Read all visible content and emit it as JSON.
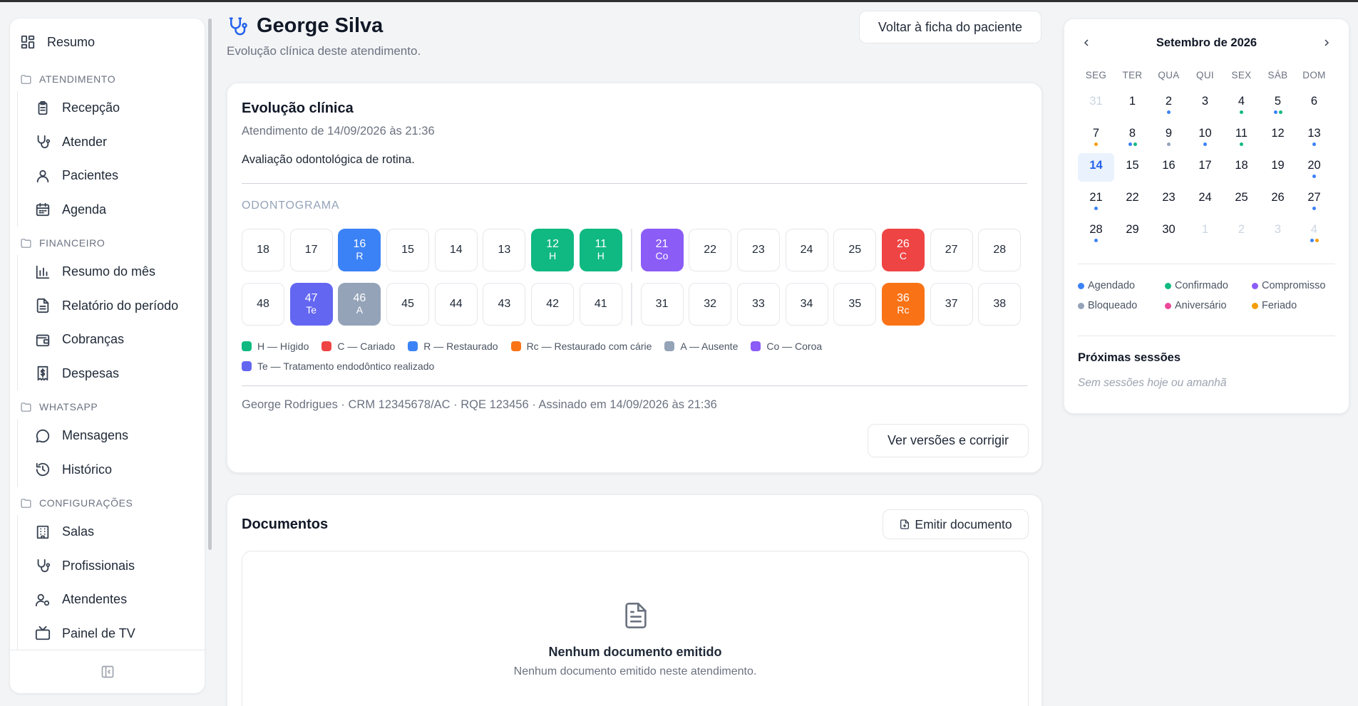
{
  "sidebar": {
    "summary_label": "Resumo",
    "sections": [
      {
        "title": "ATENDIMENTO",
        "items": [
          {
            "label": "Recepção",
            "icon": "clipboard-icon"
          },
          {
            "label": "Atender",
            "icon": "stethoscope-icon"
          },
          {
            "label": "Pacientes",
            "icon": "user-icon"
          },
          {
            "label": "Agenda",
            "icon": "calendar-icon"
          }
        ]
      },
      {
        "title": "FINANCEIRO",
        "items": [
          {
            "label": "Resumo do mês",
            "icon": "bar-chart-icon"
          },
          {
            "label": "Relatório do período",
            "icon": "file-text-icon"
          },
          {
            "label": "Cobranças",
            "icon": "wallet-icon"
          },
          {
            "label": "Despesas",
            "icon": "dollar-receipt-icon"
          }
        ]
      },
      {
        "title": "WHATSAPP",
        "items": [
          {
            "label": "Mensagens",
            "icon": "message-circle-icon"
          },
          {
            "label": "Histórico",
            "icon": "history-icon"
          }
        ]
      },
      {
        "title": "CONFIGURAÇÕES",
        "items": [
          {
            "label": "Salas",
            "icon": "building-icon"
          },
          {
            "label": "Profissionais",
            "icon": "stethoscope-icon"
          },
          {
            "label": "Atendentes",
            "icon": "user-cog-icon"
          },
          {
            "label": "Painel de TV",
            "icon": "tv-icon"
          }
        ]
      }
    ]
  },
  "header": {
    "title": "George Silva",
    "subtitle": "Evolução clínica deste atendimento.",
    "back_button": "Voltar à ficha do paciente"
  },
  "evolution": {
    "title": "Evolução clínica",
    "date": "Atendimento de 14/09/2026 às 21:36",
    "text": "Avaliação odontológica de rotina.",
    "odontogram_label": "ODONTOGRAMA",
    "upper_right": [
      {
        "n": "18",
        "code": ""
      },
      {
        "n": "17",
        "code": ""
      },
      {
        "n": "16",
        "code": "R"
      },
      {
        "n": "15",
        "code": ""
      },
      {
        "n": "14",
        "code": ""
      },
      {
        "n": "13",
        "code": ""
      },
      {
        "n": "12",
        "code": "H"
      },
      {
        "n": "11",
        "code": "H"
      }
    ],
    "upper_left": [
      {
        "n": "21",
        "code": "Co"
      },
      {
        "n": "22",
        "code": ""
      },
      {
        "n": "23",
        "code": ""
      },
      {
        "n": "24",
        "code": ""
      },
      {
        "n": "25",
        "code": ""
      },
      {
        "n": "26",
        "code": "C"
      },
      {
        "n": "27",
        "code": ""
      },
      {
        "n": "28",
        "code": ""
      }
    ],
    "lower_right": [
      {
        "n": "48",
        "code": ""
      },
      {
        "n": "47",
        "code": "Te"
      },
      {
        "n": "46",
        "code": "A"
      },
      {
        "n": "45",
        "code": ""
      },
      {
        "n": "44",
        "code": ""
      },
      {
        "n": "43",
        "code": ""
      },
      {
        "n": "42",
        "code": ""
      },
      {
        "n": "41",
        "code": ""
      }
    ],
    "lower_left": [
      {
        "n": "31",
        "code": ""
      },
      {
        "n": "32",
        "code": ""
      },
      {
        "n": "33",
        "code": ""
      },
      {
        "n": "34",
        "code": ""
      },
      {
        "n": "35",
        "code": ""
      },
      {
        "n": "36",
        "code": "Rc"
      },
      {
        "n": "37",
        "code": ""
      },
      {
        "n": "38",
        "code": ""
      }
    ],
    "legend": [
      {
        "code": "H",
        "label": "H — Hígido",
        "color": "#10b981"
      },
      {
        "code": "C",
        "label": "C — Cariado",
        "color": "#ef4444"
      },
      {
        "code": "R",
        "label": "R — Restaurado",
        "color": "#3b82f6"
      },
      {
        "code": "Rc",
        "label": "Rc — Restaurado com cárie",
        "color": "#f97316"
      },
      {
        "code": "A",
        "label": "A — Ausente",
        "color": "#94a3b8"
      },
      {
        "code": "Co",
        "label": "Co — Coroa",
        "color": "#8b5cf6"
      },
      {
        "code": "Te",
        "label": "Te — Tratamento endodôntico realizado",
        "color": "#6366f1"
      }
    ],
    "signature": "George Rodrigues · CRM 12345678/AC · RQE 123456 · Assinado em 14/09/2026 às 21:36",
    "versions_button": "Ver versões e corrigir"
  },
  "documents": {
    "title": "Documentos",
    "emit_button": "Emitir documento",
    "empty_title": "Nenhum documento emitido",
    "empty_subtitle": "Nenhum documento emitido neste atendimento."
  },
  "calendar": {
    "month": "Setembro de 2026",
    "weekdays": [
      "SEG",
      "TER",
      "QUA",
      "QUI",
      "SEX",
      "SÁB",
      "DOM"
    ],
    "today": "14",
    "weeks": [
      [
        {
          "d": "31",
          "m": true,
          "dots": []
        },
        {
          "d": "1",
          "dots": []
        },
        {
          "d": "2",
          "dots": [
            "agendado"
          ]
        },
        {
          "d": "3",
          "dots": []
        },
        {
          "d": "4",
          "dots": [
            "confirmado"
          ]
        },
        {
          "d": "5",
          "dots": [
            "agendado",
            "confirmado"
          ]
        },
        {
          "d": "6",
          "dots": []
        }
      ],
      [
        {
          "d": "7",
          "dots": [
            "feriado"
          ]
        },
        {
          "d": "8",
          "dots": [
            "agendado",
            "confirmado"
          ]
        },
        {
          "d": "9",
          "dots": [
            "bloqueado"
          ]
        },
        {
          "d": "10",
          "dots": [
            "agendado"
          ]
        },
        {
          "d": "11",
          "dots": [
            "confirmado"
          ]
        },
        {
          "d": "12",
          "dots": []
        },
        {
          "d": "13",
          "dots": [
            "agendado"
          ]
        }
      ],
      [
        {
          "d": "14",
          "dots": [],
          "today": true
        },
        {
          "d": "15",
          "dots": []
        },
        {
          "d": "16",
          "dots": []
        },
        {
          "d": "17",
          "dots": []
        },
        {
          "d": "18",
          "dots": []
        },
        {
          "d": "19",
          "dots": []
        },
        {
          "d": "20",
          "dots": [
            "agendado"
          ]
        }
      ],
      [
        {
          "d": "21",
          "dots": [
            "agendado"
          ]
        },
        {
          "d": "22",
          "dots": []
        },
        {
          "d": "23",
          "dots": []
        },
        {
          "d": "24",
          "dots": []
        },
        {
          "d": "25",
          "dots": []
        },
        {
          "d": "26",
          "dots": []
        },
        {
          "d": "27",
          "dots": [
            "agendado"
          ]
        }
      ],
      [
        {
          "d": "28",
          "dots": [
            "agendado"
          ]
        },
        {
          "d": "29",
          "dots": []
        },
        {
          "d": "30",
          "dots": []
        },
        {
          "d": "1",
          "m": true,
          "dots": []
        },
        {
          "d": "2",
          "m": true,
          "dots": []
        },
        {
          "d": "3",
          "m": true,
          "dots": []
        },
        {
          "d": "4",
          "m": true,
          "dots": [
            "agendado",
            "feriado"
          ]
        }
      ]
    ],
    "legend": [
      {
        "key": "agendado",
        "label": "Agendado",
        "color": "#3b82f6"
      },
      {
        "key": "confirmado",
        "label": "Confirmado",
        "color": "#10b981"
      },
      {
        "key": "compromisso",
        "label": "Compromisso",
        "color": "#8b5cf6"
      },
      {
        "key": "bloqueado",
        "label": "Bloqueado",
        "color": "#94a3b8"
      },
      {
        "key": "aniversario",
        "label": "Aniversário",
        "color": "#ec4899"
      },
      {
        "key": "feriado",
        "label": "Feriado",
        "color": "#f59e0b"
      }
    ],
    "next_sessions_title": "Próximas sessões",
    "next_sessions_empty": "Sem sessões hoje ou amanhã"
  }
}
